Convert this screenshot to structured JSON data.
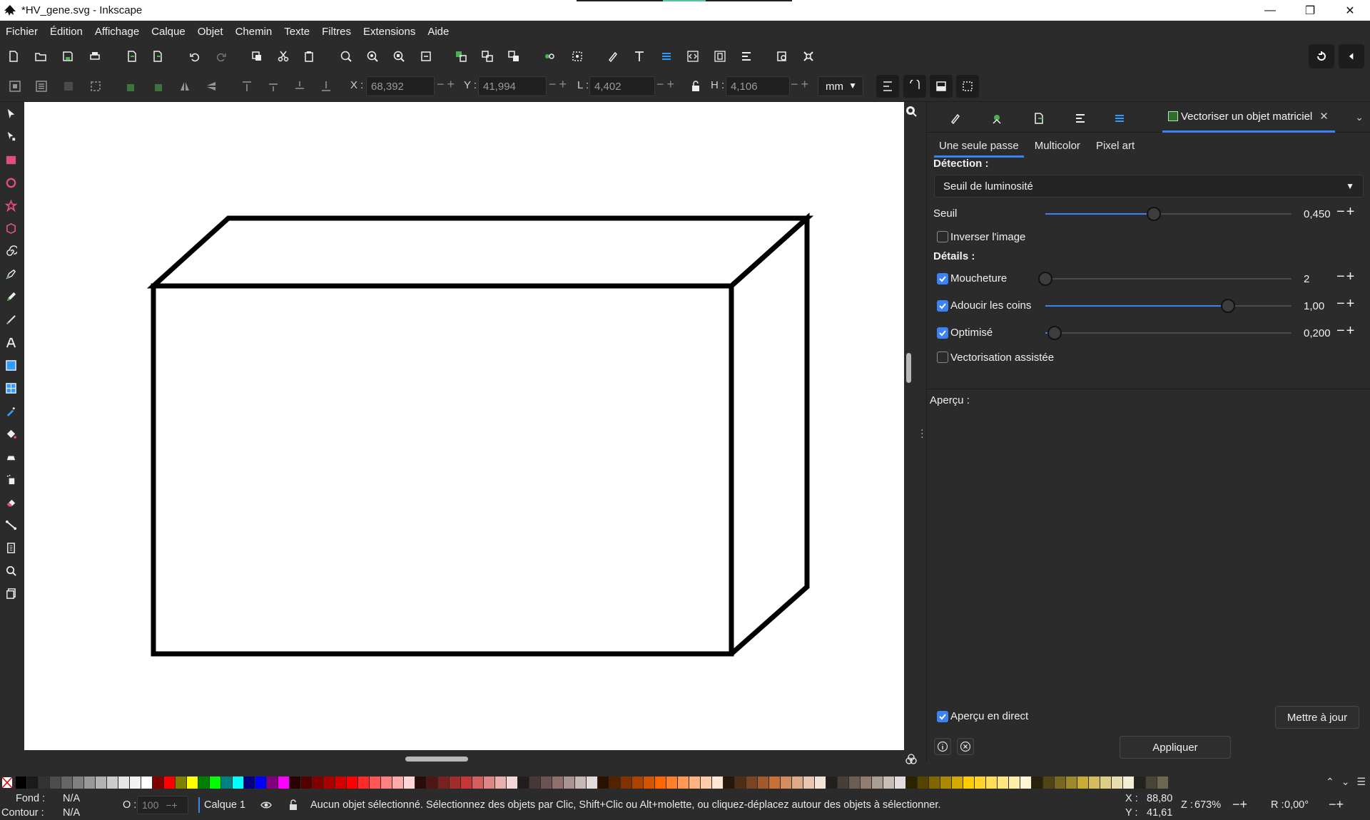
{
  "window": {
    "title": "*HV_gene.svg - Inkscape",
    "controls": {
      "minimize": "—",
      "restore": "❐",
      "close": "✕"
    }
  },
  "menu": [
    "Fichier",
    "Édition",
    "Affichage",
    "Calque",
    "Objet",
    "Chemin",
    "Texte",
    "Filtres",
    "Extensions",
    "Aide"
  ],
  "tool_controls": {
    "x_label": "X :",
    "x_value": "68,392",
    "y_label": "Y :",
    "y_value": "41,994",
    "w_label": "L :",
    "w_value": "4,402",
    "h_label": "H :",
    "h_value": "4,106",
    "unit": "mm"
  },
  "panel": {
    "dialog_title": "Vectoriser un objet matriciel",
    "mode_tabs": [
      "Une seule passe",
      "Multicolor",
      "Pixel art"
    ],
    "detection_label": "Détection :",
    "detection_value": "Seuil de luminosité",
    "threshold_label": "Seuil",
    "threshold_value": "0,450",
    "threshold_fraction": 0.45,
    "invert_label": "Inverser l'image",
    "invert_checked": false,
    "details_label": "Détails :",
    "speckles_label": "Moucheture",
    "speckles_value": "2",
    "speckles_checked": true,
    "smooth_label": "Adoucir les coins",
    "smooth_value": "1,00",
    "smooth_checked": true,
    "optimize_label": "Optimisé",
    "optimize_value": "0,200",
    "optimize_checked": true,
    "assisted_label": "Vectorisation assistée",
    "assisted_checked": false,
    "preview_label": "Aperçu :",
    "live_preview_label": "Aperçu en direct",
    "live_preview_checked": true,
    "update_button": "Mettre à jour",
    "apply_button": "Appliquer"
  },
  "status": {
    "fill_label": "Fond :",
    "fill_value": "N/A",
    "stroke_label": "Contour :",
    "stroke_value": "N/A",
    "opacity_label": "O :",
    "opacity_value": "100",
    "layer": "Calque 1",
    "message": "Aucun objet sélectionné. Sélectionnez des objets par Clic, Shift+Clic ou Alt+molette, ou cliquez-déplacez autour des objets à sélectionner.",
    "cursor_x_label": "X :",
    "cursor_x": "88,80",
    "cursor_y_label": "Y :",
    "cursor_y": "41,61",
    "zoom_label": "Z :",
    "zoom": "673%",
    "rotation_label": "R :",
    "rotation": "0,00°"
  },
  "colors": {
    "accent": "#3b82f6",
    "canvas": "#ffffff",
    "ui_bg": "#2b2b2b"
  },
  "palette": [
    "#000000",
    "#1a1a1a",
    "#333333",
    "#4d4d4d",
    "#666666",
    "#808080",
    "#999999",
    "#b3b3b3",
    "#cccccc",
    "#e6e6e6",
    "#f2f2f2",
    "#ffffff",
    "#800000",
    "#ff0000",
    "#808000",
    "#ffff00",
    "#008000",
    "#00ff00",
    "#008080",
    "#00ffff",
    "#000080",
    "#0000ff",
    "#800080",
    "#ff00ff",
    "#2b0000",
    "#550000",
    "#800000",
    "#aa0000",
    "#d40000",
    "#ff0000",
    "#ff2a2a",
    "#ff5555",
    "#ff8080",
    "#ffaaaa",
    "#ffd5d5",
    "#280b0b",
    "#501616",
    "#782121",
    "#a02c2c",
    "#c83737",
    "#d35f5f",
    "#de8787",
    "#e9afaf",
    "#f4d7d7",
    "#241c1c",
    "#483737",
    "#6c5353",
    "#916f6f",
    "#ac9393",
    "#c8b7b7",
    "#e3dbdb",
    "#2b1100",
    "#552200",
    "#803300",
    "#aa4400",
    "#d45500",
    "#ff6600",
    "#ff7f2a",
    "#ff9955",
    "#ffb380",
    "#ffccaa",
    "#ffe6d5",
    "#28170b",
    "#502d16",
    "#784421",
    "#a05a2c",
    "#c87137",
    "#d38d5f",
    "#deaa87",
    "#e9c6af",
    "#f4e3d7",
    "#241f1c",
    "#483e37",
    "#6c5d53",
    "#917c6f",
    "#ac9d93",
    "#c8beb7",
    "#e3dedb",
    "#2b2200",
    "#554400",
    "#806600",
    "#aa8800",
    "#d4aa00",
    "#ffcc00",
    "#ffd42a",
    "#ffdd55",
    "#ffe680",
    "#ffeeaa",
    "#fff6d5",
    "#28220b",
    "#504416",
    "#786721",
    "#a0892c",
    "#c8ab37",
    "#d3bc5f",
    "#decd87",
    "#e9ddaf",
    "#f4eed7",
    "#24221c",
    "#484537",
    "#6c6753"
  ]
}
